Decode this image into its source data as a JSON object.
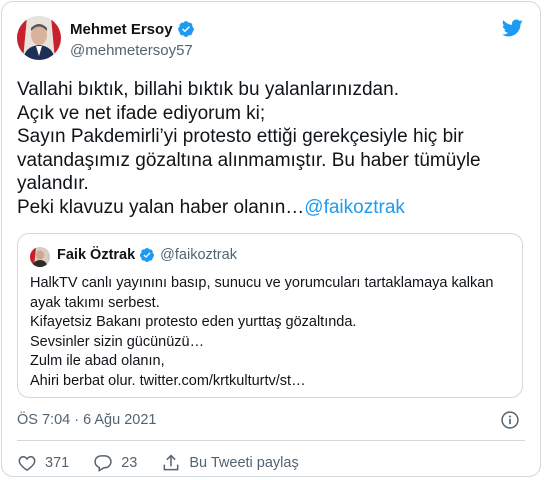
{
  "author": {
    "name": "Mehmet Ersoy",
    "handle": "@mehmetersoy57"
  },
  "tweet": {
    "text_lines": [
      "Vallahi bıktık, billahi bıktık bu yalanlarınızdan.",
      "Açık ve net ifade ediyorum ki;",
      "Sayın Pakdemirli’yi protesto ettiği gerekçesiyle hiç bir vatandaşımız gözaltına alınmamıştır. Bu haber tümüyle yalandır."
    ],
    "last_line_prefix": "Peki klavuzu yalan haber olanın…",
    "mention": "@faikoztrak"
  },
  "quoted": {
    "name": "Faik Öztrak",
    "handle": "@faikoztrak",
    "text": "HalkTV canlı yayınını basıp, sunucu ve yorumcuları tartaklamaya kalkan ayak takımı serbest.\nKifayetsiz Bakanı protesto eden yurttaş gözaltında.\nSevsinler sizin gücünüzü…\nZulm ile abad olanın,\nAhiri berbat olur. twitter.com/krtkulturtv/st…"
  },
  "meta": {
    "timestamp": "ÖS 7:04 · 6 Ağu 2021"
  },
  "actions": {
    "like_count": "371",
    "reply_count": "23",
    "share_label": "Bu Tweeti paylaş"
  },
  "colors": {
    "accent": "#1d9bf0",
    "like_red": "#f91880",
    "secondary_text": "#536471",
    "border": "#cfd9de"
  },
  "icons": [
    "verified-badge-icon",
    "twitter-bird-icon",
    "info-icon",
    "heart-icon",
    "reply-bubble-icon",
    "share-icon"
  ]
}
